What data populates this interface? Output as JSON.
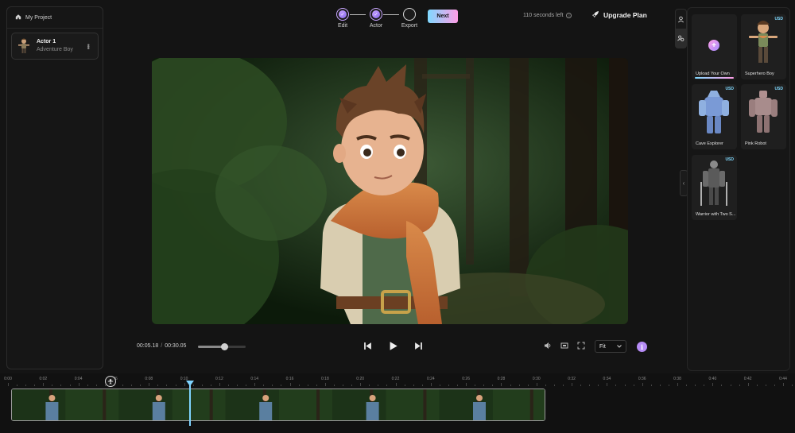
{
  "breadcrumb": {
    "project": "My Project"
  },
  "actor": {
    "name": "Actor 1",
    "subtitle": "Adventure Boy"
  },
  "stepper": {
    "steps": [
      {
        "label": "Edit",
        "state": "done"
      },
      {
        "label": "Actor",
        "state": "done"
      },
      {
        "label": "Export",
        "state": "pending"
      }
    ],
    "next_label": "Next"
  },
  "header": {
    "seconds_left": "110 seconds left",
    "upgrade_label": "Upgrade Plan"
  },
  "playback": {
    "current": "00:05.18",
    "separator": "/",
    "total": "00:30.05",
    "volume_level": 0.55
  },
  "view": {
    "fit_label": "Fit",
    "info_label": "i"
  },
  "actors_library": [
    {
      "name": "Upload Your Own",
      "badge": "",
      "kind": "upload"
    },
    {
      "name": "Superhero Boy",
      "badge": "USD",
      "kind": "boy"
    },
    {
      "name": "Cave Explorer",
      "badge": "USD",
      "kind": "blue"
    },
    {
      "name": "Pink Robot",
      "badge": "USD",
      "kind": "robot"
    },
    {
      "name": "Warrior with Two S...",
      "badge": "USD",
      "kind": "warrior"
    }
  ],
  "timeline": {
    "ticks": [
      "0:00",
      "0:02",
      "0:04",
      "0:06",
      "0:08",
      "0:10",
      "0:12",
      "0:14",
      "0:16",
      "0:18",
      "0:20",
      "0:22",
      "0:24",
      "0:26",
      "0:28",
      "0:30",
      "0:32",
      "0:34",
      "0:36",
      "0:38",
      "0:40",
      "0:42",
      "0:44"
    ]
  },
  "colors": {
    "accent": "#b68cf6",
    "playhead": "#7fd4ff",
    "next_gradient_start": "#7fd9ff",
    "next_gradient_end": "#ff9de6"
  },
  "icons": [
    "home-icon",
    "kebab-menu-icon",
    "check-icon",
    "rocket-icon",
    "info-icon",
    "skip-back-icon",
    "play-icon",
    "skip-forward-icon",
    "volume-icon",
    "screen-icon",
    "fullscreen-icon",
    "chevron-down-icon",
    "person-icon",
    "people-icon",
    "chevron-left-icon",
    "plus-icon"
  ]
}
